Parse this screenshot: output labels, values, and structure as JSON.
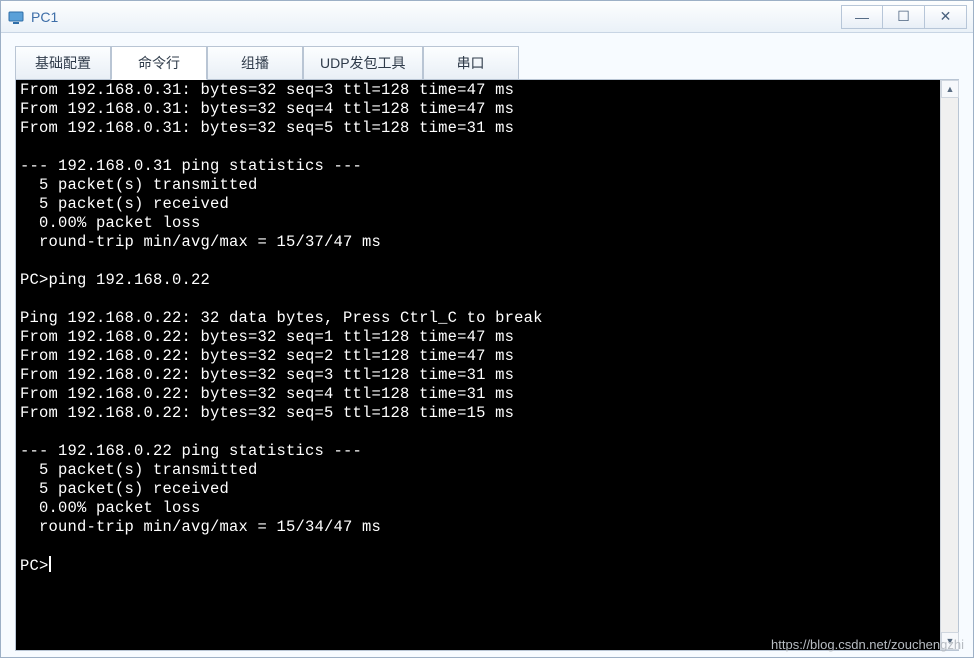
{
  "window": {
    "title": "PC1"
  },
  "tabs": [
    {
      "label": "基础配置",
      "id": "basic"
    },
    {
      "label": "命令行",
      "id": "cli",
      "active": true
    },
    {
      "label": "组播",
      "id": "multicast"
    },
    {
      "label": "UDP发包工具",
      "id": "udp"
    },
    {
      "label": "串口",
      "id": "serial"
    }
  ],
  "terminal": {
    "prompt": "PC>",
    "lines": [
      "From 192.168.0.31: bytes=32 seq=3 ttl=128 time=47 ms",
      "From 192.168.0.31: bytes=32 seq=4 ttl=128 time=47 ms",
      "From 192.168.0.31: bytes=32 seq=5 ttl=128 time=31 ms",
      "",
      "--- 192.168.0.31 ping statistics ---",
      "  5 packet(s) transmitted",
      "  5 packet(s) received",
      "  0.00% packet loss",
      "  round-trip min/avg/max = 15/37/47 ms",
      "",
      "PC>ping 192.168.0.22",
      "",
      "Ping 192.168.0.22: 32 data bytes, Press Ctrl_C to break",
      "From 192.168.0.22: bytes=32 seq=1 ttl=128 time=47 ms",
      "From 192.168.0.22: bytes=32 seq=2 ttl=128 time=47 ms",
      "From 192.168.0.22: bytes=32 seq=3 ttl=128 time=31 ms",
      "From 192.168.0.22: bytes=32 seq=4 ttl=128 time=31 ms",
      "From 192.168.0.22: bytes=32 seq=5 ttl=128 time=15 ms",
      "",
      "--- 192.168.0.22 ping statistics ---",
      "  5 packet(s) transmitted",
      "  5 packet(s) received",
      "  0.00% packet loss",
      "  round-trip min/avg/max = 15/34/47 ms",
      ""
    ]
  },
  "watermark": "https://blog.csdn.net/zouchengzhi"
}
